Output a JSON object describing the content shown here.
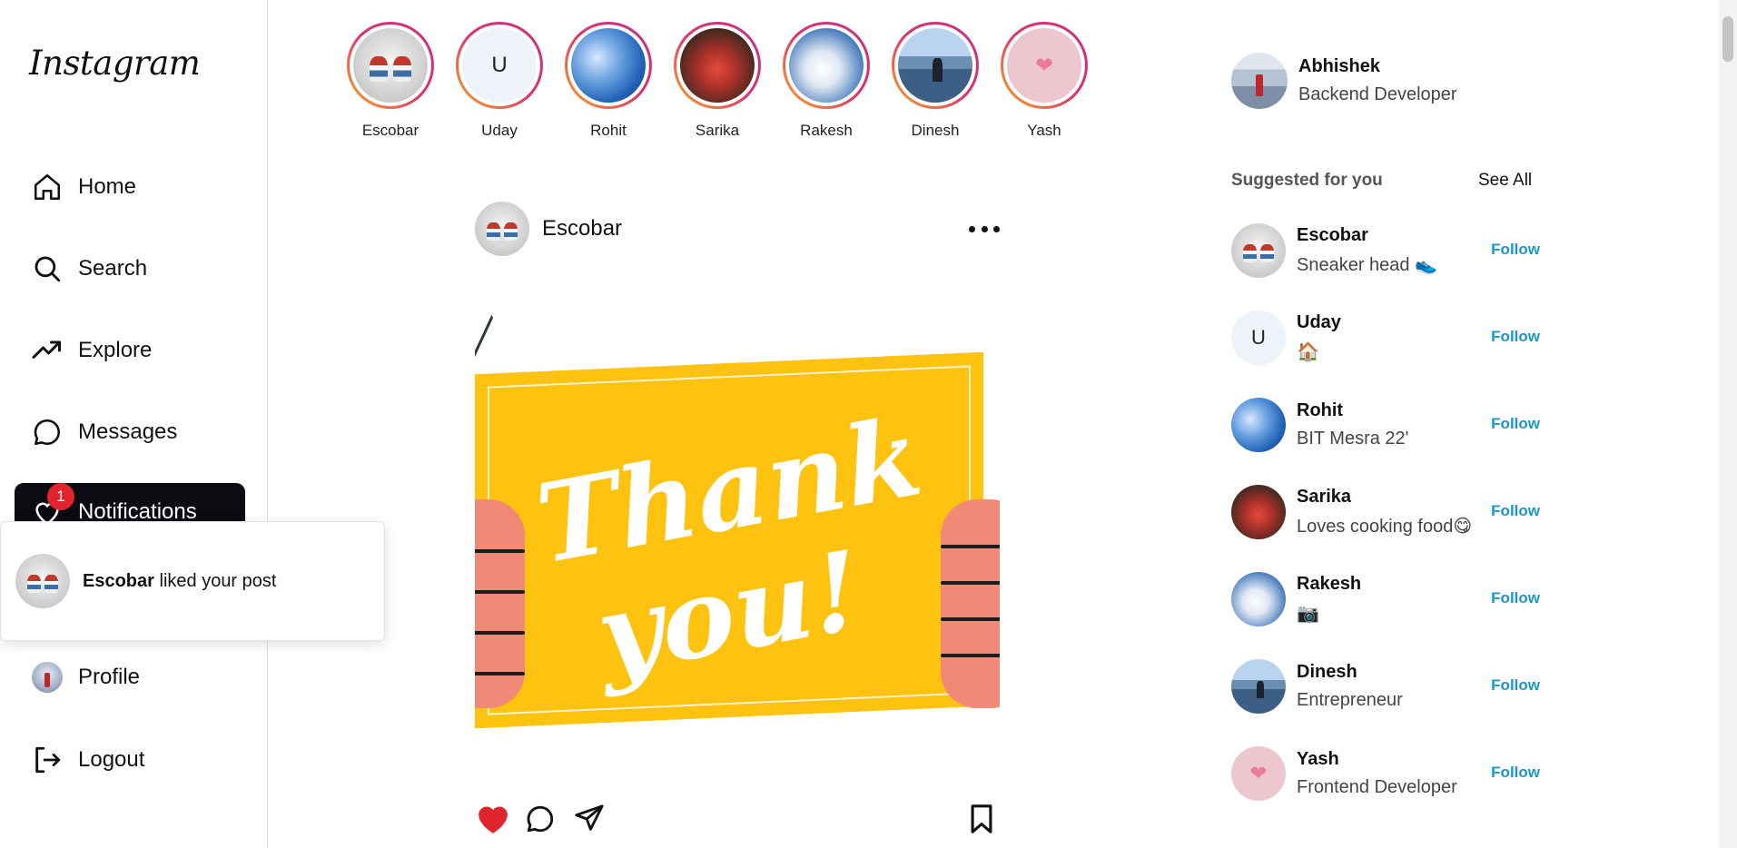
{
  "app": {
    "logo": "Instagram"
  },
  "sidebar": {
    "items": [
      {
        "label": "Home",
        "icon": "home-icon"
      },
      {
        "label": "Search",
        "icon": "search-icon"
      },
      {
        "label": "Explore",
        "icon": "trending-icon"
      },
      {
        "label": "Messages",
        "icon": "message-icon"
      },
      {
        "label": "Notifications",
        "icon": "heart-icon",
        "badge": "1"
      },
      {
        "label": "Profile",
        "icon": "avatar"
      },
      {
        "label": "Logout",
        "icon": "logout-icon"
      }
    ]
  },
  "notification_popup": {
    "user": "Escobar",
    "text": "liked your post"
  },
  "stories": [
    {
      "name": "Escobar"
    },
    {
      "name": "Uday",
      "initial": "U"
    },
    {
      "name": "Rohit"
    },
    {
      "name": "Sarika"
    },
    {
      "name": "Rakesh"
    },
    {
      "name": "Dinesh"
    },
    {
      "name": "Yash"
    }
  ],
  "post": {
    "user": "Escobar",
    "image_text_line1": "Thank",
    "image_text_line2": "you!",
    "liked": true
  },
  "current_user": {
    "name": "Abhishek",
    "role": "Backend Developer"
  },
  "suggestions": {
    "title": "Suggested for you",
    "see_all": "See All",
    "follow_label": "Follow",
    "users": [
      {
        "name": "Escobar",
        "bio": "Sneaker head 👟"
      },
      {
        "name": "Uday",
        "bio": "🏠",
        "initial": "U"
      },
      {
        "name": "Rohit",
        "bio": "BIT Mesra 22'"
      },
      {
        "name": "Sarika",
        "bio": "Loves cooking food😋"
      },
      {
        "name": "Rakesh",
        "bio": "📷"
      },
      {
        "name": "Dinesh",
        "bio": "Entrepreneur"
      },
      {
        "name": "Yash",
        "bio": "Frontend Developer"
      }
    ]
  },
  "colors": {
    "accent_link": "#1a94d8",
    "like": "#e0242e",
    "active_nav": "#0b0b12"
  }
}
